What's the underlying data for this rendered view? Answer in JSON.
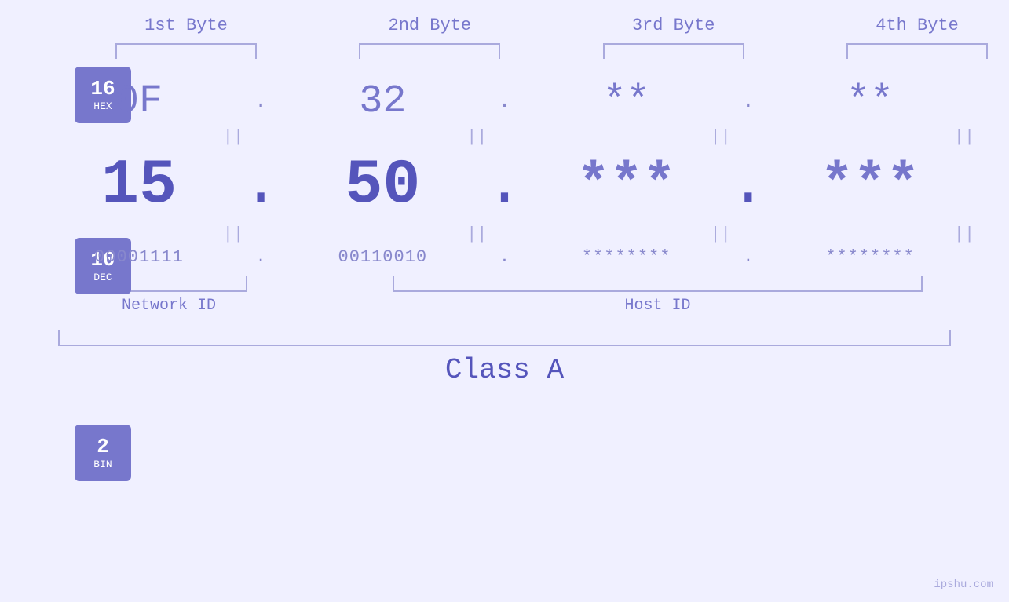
{
  "bytes": {
    "labels": [
      "1st Byte",
      "2nd Byte",
      "3rd Byte",
      "4th Byte"
    ]
  },
  "badges": [
    {
      "num": "16",
      "label": "HEX"
    },
    {
      "num": "10",
      "label": "DEC"
    },
    {
      "num": "2",
      "label": "BIN"
    }
  ],
  "hex_row": {
    "values": [
      "0F",
      "32",
      "**",
      "**"
    ],
    "dots": [
      ".",
      ".",
      ".",
      ""
    ]
  },
  "dec_row": {
    "values": [
      "15",
      "50",
      "***",
      "***"
    ],
    "dots": [
      ".",
      ".",
      ".",
      ""
    ]
  },
  "bin_row": {
    "values": [
      "00001111",
      "00110010",
      "********",
      "********"
    ],
    "dots": [
      ".",
      ".",
      ".",
      ""
    ]
  },
  "equals": "||",
  "network_id": "Network ID",
  "host_id": "Host ID",
  "class_label": "Class A",
  "watermark": "ipshu.com"
}
